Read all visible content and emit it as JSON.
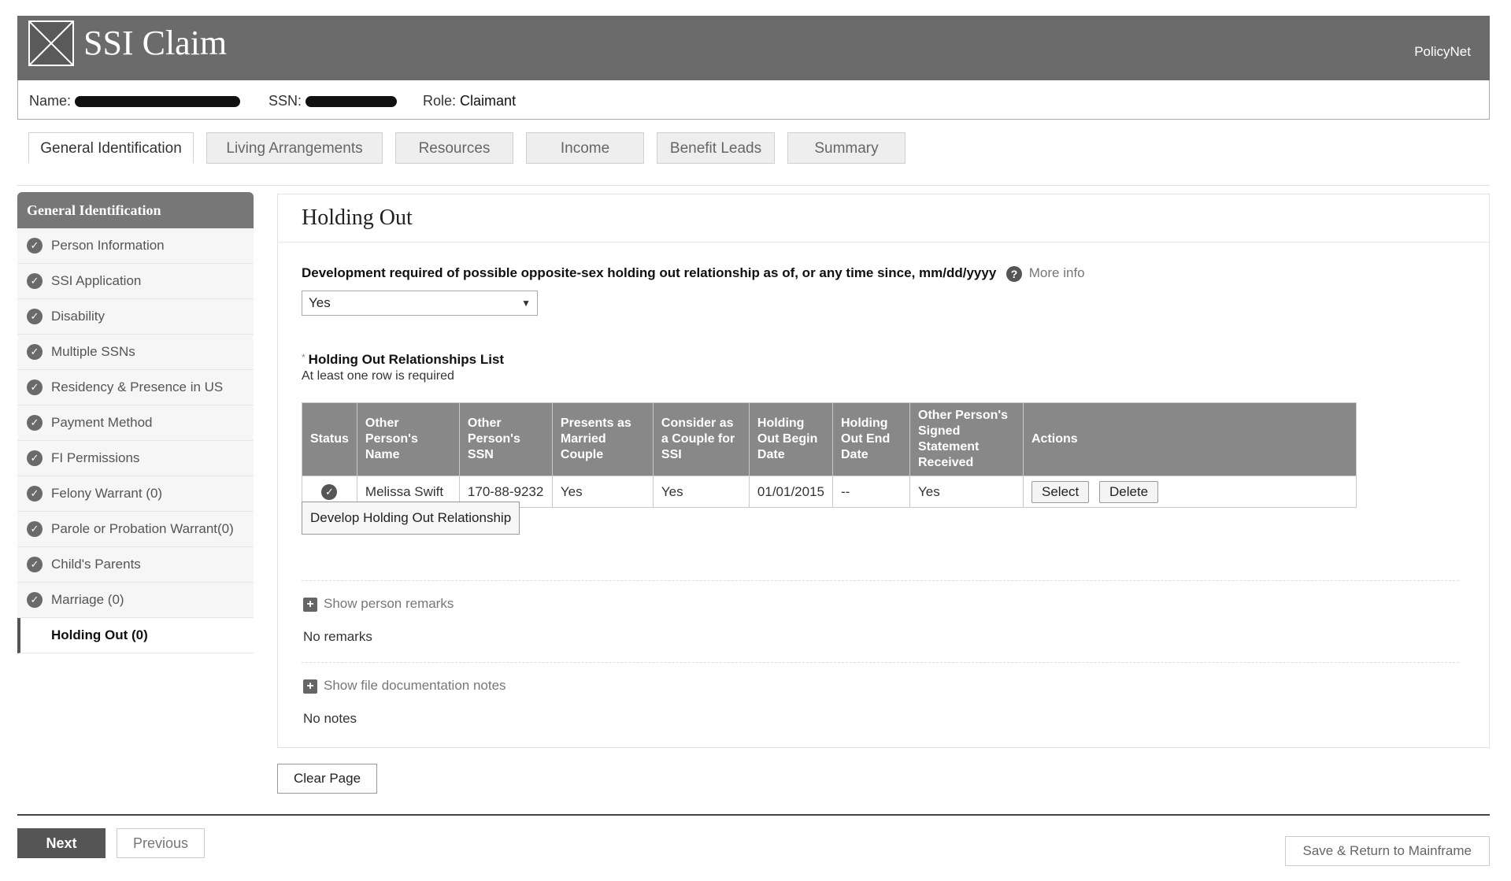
{
  "header": {
    "title": "SSI Claim",
    "brand": "PolicyNet",
    "logo_icon": "broken-image-icon"
  },
  "info": {
    "name_label": "Name:",
    "ssn_label": "SSN:",
    "role_label": "Role:",
    "role_value": "Claimant"
  },
  "tabs": [
    {
      "label": "General Identification",
      "active": true
    },
    {
      "label": "Living Arrangements"
    },
    {
      "label": "Resources"
    },
    {
      "label": "Income"
    },
    {
      "label": "Benefit Leads"
    },
    {
      "label": "Summary"
    }
  ],
  "sidebar": {
    "heading": "General Identification",
    "check_icon": "check-circle-icon",
    "items": [
      {
        "label": "Person Information"
      },
      {
        "label": "SSI Application"
      },
      {
        "label": "Disability"
      },
      {
        "label": "Multiple SSNs"
      },
      {
        "label": "Residency & Presence in US"
      },
      {
        "label": "Payment Method"
      },
      {
        "label": "FI Permissions"
      },
      {
        "label": "Felony Warrant (0)"
      },
      {
        "label": "Parole or Probation Warrant(0)"
      },
      {
        "label": "Child's Parents"
      },
      {
        "label": "Marriage (0)"
      },
      {
        "label": "Holding Out (0)"
      }
    ]
  },
  "main": {
    "title": "Holding Out",
    "question": "Development required of possible opposite-sex holding out relationship as of, or any time since, mm/dd/yyyy",
    "more_info": "More info",
    "help_glyph": "?",
    "select_value": "Yes",
    "list_required_mark": "*",
    "list_title": "Holding Out Relationships List",
    "list_subtitle": "At least one row is required",
    "table": {
      "headers": [
        "Status",
        "Other Person's Name",
        "Other Person's SSN",
        "Presents as Married Couple",
        "Consider as a Couple for SSI",
        "Holding Out Begin Date",
        "Holding Out End Date",
        "Other Person's Signed Statement Received",
        "Actions"
      ],
      "rows": [
        {
          "name": "Melissa Swift",
          "ssn": "170-88-9232",
          "married": "Yes",
          "couple": "Yes",
          "begin": "01/01/2015",
          "end": "--",
          "signed": "Yes"
        }
      ],
      "select_label": "Select",
      "delete_label": "Delete"
    },
    "develop_button": "Develop Holding Out Relationship",
    "person_remarks_toggle": "Show person remarks",
    "person_remarks_text": "No remarks",
    "file_notes_toggle": "Show file documentation notes",
    "file_notes_text": "No notes"
  },
  "clear_button": "Clear Page",
  "footer": {
    "next": "Next",
    "previous": "Previous",
    "save_return": "Save & Return to Mainframe"
  }
}
